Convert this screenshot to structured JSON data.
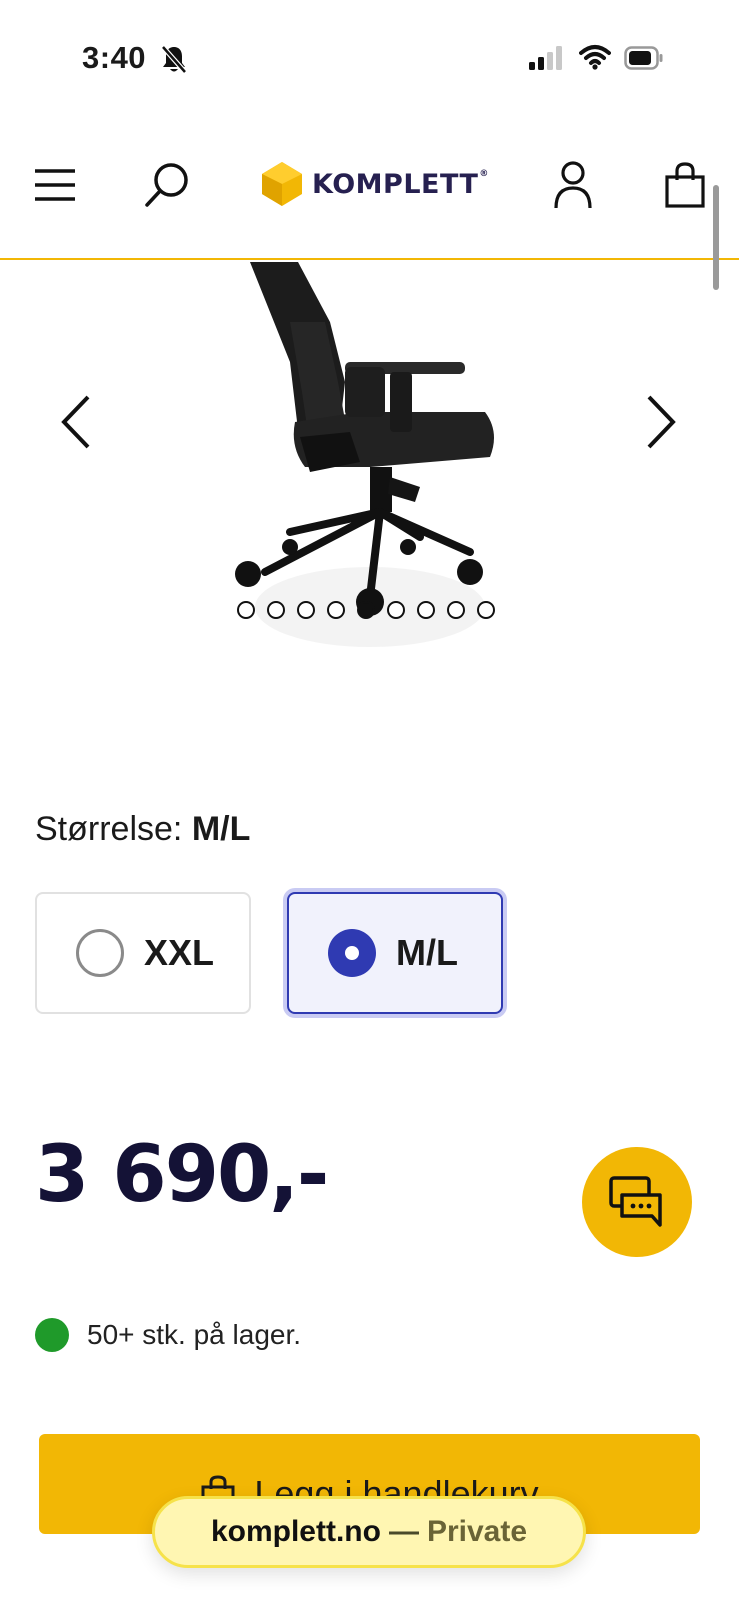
{
  "status_bar": {
    "time": "3:40",
    "icons": [
      "bell-slash-icon",
      "signal-icon",
      "wifi-icon",
      "battery-icon"
    ]
  },
  "header": {
    "logo_text": "KOMPLETT",
    "logo_mark": "®",
    "icons": [
      "menu-icon",
      "search-icon",
      "user-icon",
      "cart-icon"
    ],
    "accent_color": "#f2b705"
  },
  "gallery": {
    "total_images": 9,
    "active_index": 5
  },
  "size": {
    "label_prefix": "Størrelse:",
    "selected_value": "M/L",
    "options": [
      {
        "label": "XXL",
        "selected": false
      },
      {
        "label": "M/L",
        "selected": true
      }
    ]
  },
  "price": {
    "amount": "3 690,-"
  },
  "stock": {
    "text": "50+ stk. på lager.",
    "status_color": "#1f9a2a"
  },
  "cart_button": {
    "label": "Legg i handlekurv"
  },
  "browser": {
    "host": "komplett.no",
    "separator": "—",
    "mode": "Private"
  },
  "colors": {
    "brand_yellow": "#f2b705",
    "selection_blue": "#2f3ab2",
    "price_navy": "#141236"
  }
}
